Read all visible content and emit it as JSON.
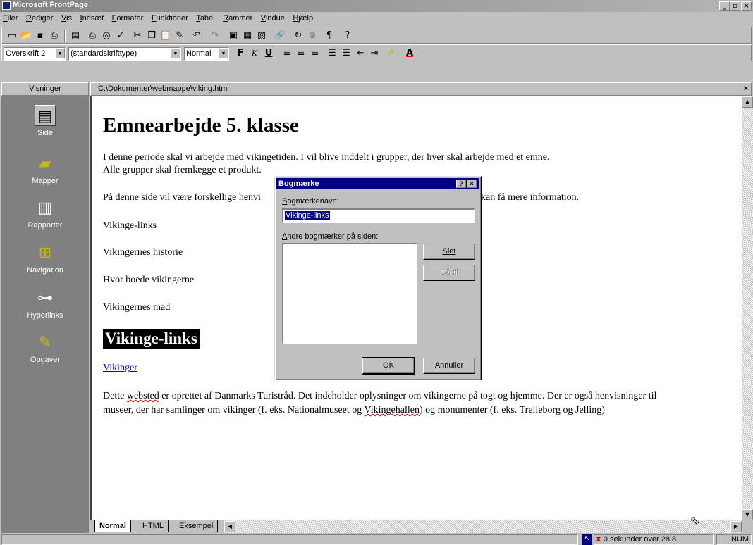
{
  "window": {
    "title": "Microsoft FrontPage"
  },
  "menu": [
    "Filer",
    "Rediger",
    "Vis",
    "Indsæt",
    "Formater",
    "Funktioner",
    "Tabel",
    "Rammer",
    "Vindue",
    "Hjælp"
  ],
  "format_toolbar": {
    "style": "Overskrift 2",
    "font": "(standardskrifttype)",
    "size": "Normal",
    "bold": "F",
    "italic": "K",
    "underline": "U"
  },
  "views": {
    "header": "Visninger",
    "items": [
      {
        "label": "Side",
        "icon": "page-view-icon"
      },
      {
        "label": "Mapper",
        "icon": "folder-view-icon"
      },
      {
        "label": "Rapporter",
        "icon": "reports-view-icon"
      },
      {
        "label": "Navigation",
        "icon": "navigation-view-icon"
      },
      {
        "label": "Hyperlinks",
        "icon": "hyperlinks-view-icon"
      },
      {
        "label": "Opgaver",
        "icon": "tasks-view-icon"
      }
    ]
  },
  "document": {
    "path": "C:\\Dokumenter\\webmappe\\viking.htm",
    "heading": "Emnearbejde 5. klasse",
    "intro1": "I denne periode skal vi arbejde med vikingetiden. I vil blive inddelt i grupper, der hver skal arbejde med et emne.",
    "intro2": "Alle grupper skal fremlægge et produkt.",
    "intro3a": "På denne side vil være forskellige henvi",
    "intro3b": "kan få mere information.",
    "toc": [
      "Vikinge-links",
      "Vikingernes historie",
      "Hvor boede vikingerne",
      "Vikingernes mad"
    ],
    "section_heading": "Vikinge-links",
    "link": "Vikinger",
    "body1_a": "Dette ",
    "body1_b": "websted",
    "body1_c": " er oprettet af Danmarks Turistråd. Det indeholder oplysninger om vikingerne på togt og hjemme. Der er også henvisninger til",
    "body2_a": "museer, der har samlinger om vikinger (f. eks. Nationalmuseet og ",
    "body2_b": "Vikingehallen",
    "body2_c": ") og monumenter (f. eks. Trelleborg og Jelling)"
  },
  "tabs": [
    "Normal",
    "HTML",
    "Eksempel"
  ],
  "status": {
    "download": "0 sekunder over 28.8",
    "num": "NUM"
  },
  "dialog": {
    "title": "Bogmærke",
    "name_label": "Bogmærkenavn:",
    "name_value": "Vikinge-links",
    "others_label": "Andre bogmærker på siden:",
    "delete": "Slet",
    "goto": "Gå til",
    "ok": "OK",
    "cancel": "Annuller"
  }
}
